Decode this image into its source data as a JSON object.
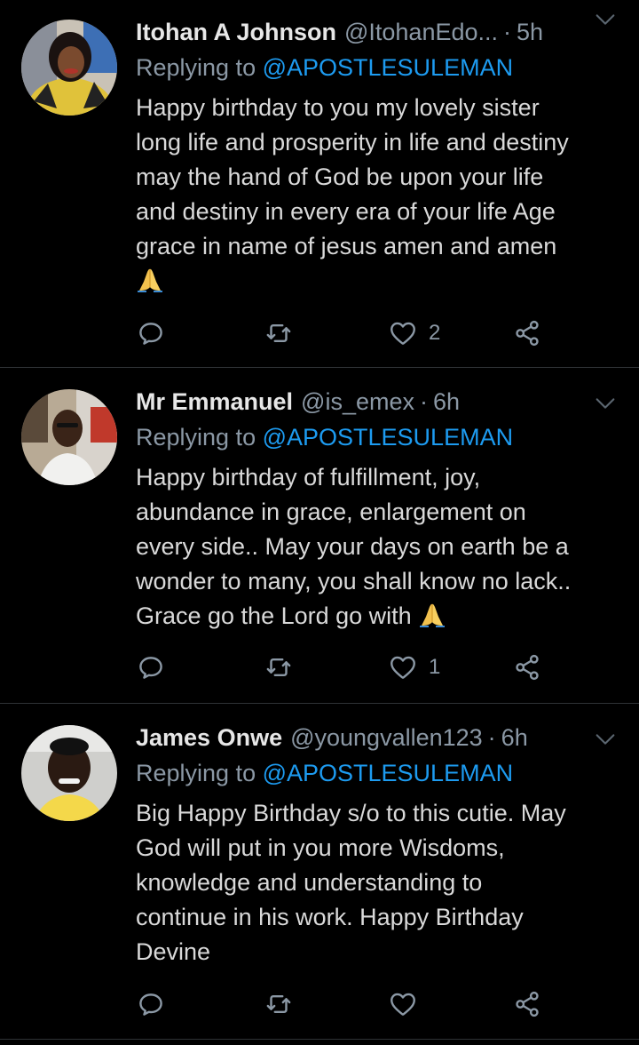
{
  "tweets": [
    {
      "name": "Itohan A Johnson",
      "handle": "@ItohanEdo...",
      "separator": "·",
      "time": "5h",
      "replying_prefix": "Replying to ",
      "replying_to": "@APOSTLESULEMAN",
      "lines": [
        "Happy birthday to you my lovely sister",
        "long life and prosperity in life and destiny",
        "may the hand of God be upon your life",
        "and destiny in every era of your life Age",
        "grace in name of jesus amen and amen"
      ],
      "likes": "2"
    },
    {
      "name": "Mr Emmanuel",
      "handle": "@is_emex",
      "separator": "·",
      "time": "6h",
      "replying_prefix": "Replying to ",
      "replying_to": "@APOSTLESULEMAN",
      "lines": [
        "Happy birthday of fulfillment, joy,",
        "abundance in grace, enlargement on",
        "every side.. May your days on earth be a",
        "wonder to many, you shall know no lack..",
        "Grace go the Lord go with"
      ],
      "likes": "1"
    },
    {
      "name": "James Onwe",
      "handle": "@youngvallen123",
      "separator": "·",
      "time": "6h",
      "replying_prefix": "Replying to ",
      "replying_to": "@APOSTLESULEMAN",
      "lines": [
        "Big Happy Birthday s/o to this cutie. May",
        "God will put in you more Wisdoms,",
        "knowledge and understanding to",
        "continue in his work. Happy Birthday",
        "Devine"
      ],
      "likes": ""
    }
  ],
  "icons": {
    "reply": "reply-icon",
    "retweet": "retweet-icon",
    "like": "heart-icon",
    "share": "share-icon",
    "emoji": "folded-hands-emoji",
    "caret": "chevron-down-icon"
  },
  "colors": {
    "background": "#000000",
    "text": "#d9d9d9",
    "muted": "#8b98a5",
    "mention": "#1d9bf0",
    "divider": "#2f3336"
  }
}
